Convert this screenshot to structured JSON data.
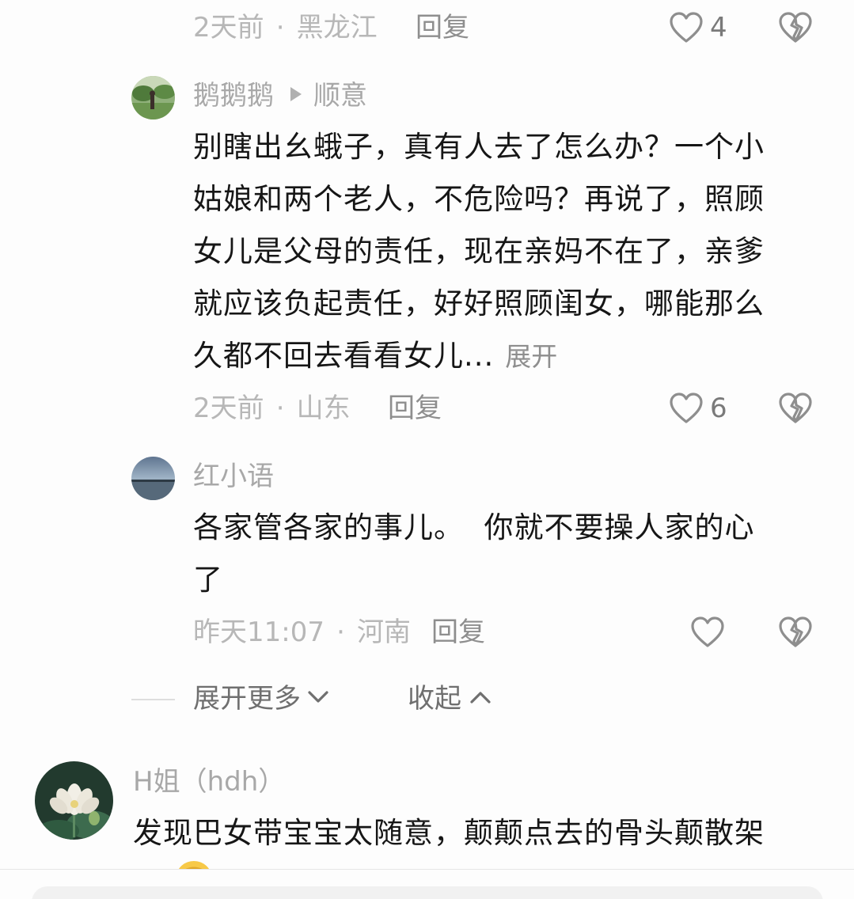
{
  "comments": {
    "c0": {
      "time": "2天前",
      "location": "黑龙江",
      "reply_label": "回复",
      "like_count": "4"
    },
    "c1": {
      "username": "鹅鹅鹅",
      "reply_to": "顺意",
      "lines": [
        "别瞎出幺蛾子，真有人去了怎么办？一个小",
        "姑娘和两个老人，不危险吗？再说了，照顾",
        "女儿是父母的责任，现在亲妈不在了，亲爹",
        "就应该负起责任，好好照顾闺女，哪能那么",
        "久都不回去看看女儿..."
      ],
      "expand_label": "展开",
      "time": "2天前",
      "location": "山东",
      "reply_label": "回复",
      "like_count": "6"
    },
    "c2": {
      "username": "红小语",
      "lines": [
        "各家管各家的事儿。  你就不要操人家的心",
        "了"
      ],
      "time": "昨天11:07",
      "location": "河南",
      "reply_label": "回复",
      "like_count": ""
    },
    "thread_controls": {
      "expand_more_label": "展开更多",
      "collapse_label": "收起"
    },
    "c3": {
      "username": "H姐（hdh）",
      "lines": [
        "发现巴女带宝宝太随意，颠颠点去的骨头颠散架"
      ]
    }
  },
  "separator": "·",
  "icons": {
    "like": "heart-outline-icon",
    "dislike": "broken-heart-icon",
    "reply_arrow": "play-triangle-icon",
    "expand": "chevron-down-icon",
    "collapse": "chevron-up-icon",
    "emoji": "emoji-icon"
  },
  "colors": {
    "meta_gray": "#b7b7b7",
    "reply_gray": "#8e8e8e",
    "text": "#161616"
  }
}
